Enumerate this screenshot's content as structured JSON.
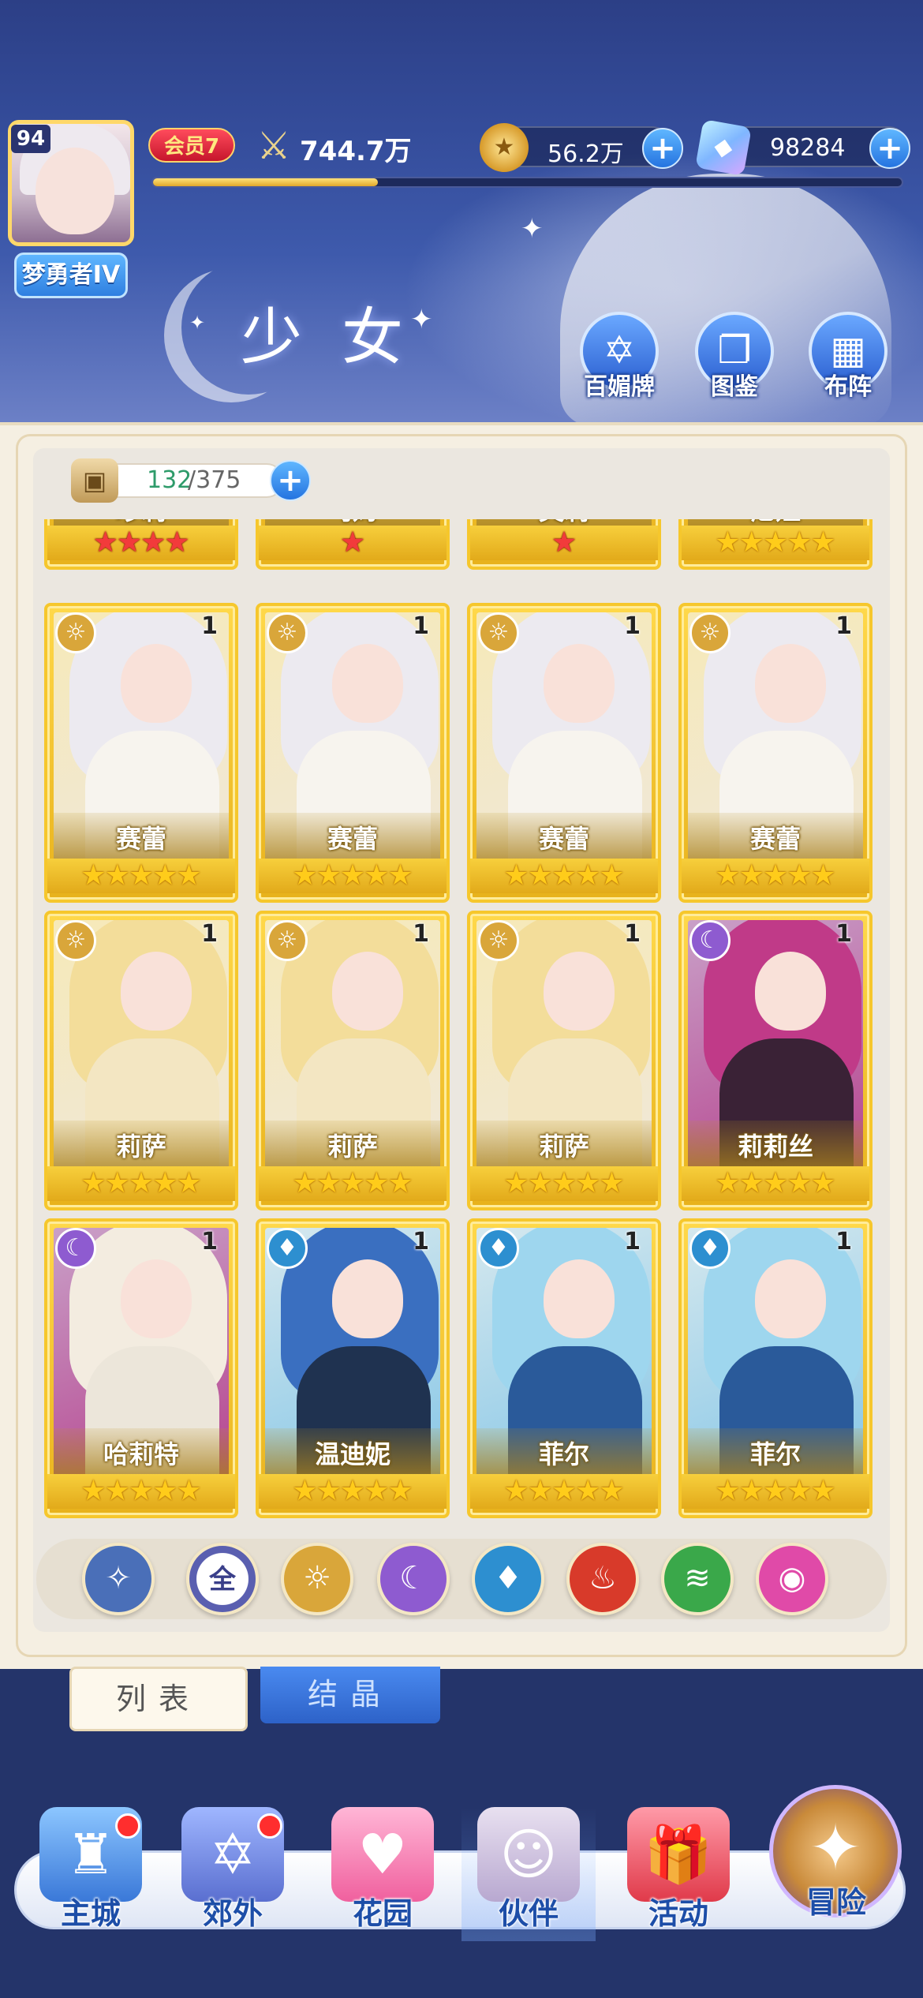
{
  "header": {
    "player_level": "94",
    "rank_title": "梦勇者IV",
    "vip_label": "会员7",
    "power_value": "744.7万",
    "power_progress": 0.3,
    "gold_value": "56.2万",
    "gem_value": "98284",
    "page_title": "少女",
    "menu": [
      {
        "label": "百媚牌",
        "icon": "card-deck-icon"
      },
      {
        "label": "图鉴",
        "icon": "book-icon"
      },
      {
        "label": "布阵",
        "icon": "formation-grid-icon"
      }
    ]
  },
  "collection": {
    "current": "132",
    "total": "/375"
  },
  "partial_row": [
    {
      "name": "珍莉",
      "stars": 4,
      "star_color": "red"
    },
    {
      "name": "乌姆",
      "stars": 1,
      "star_color": "red"
    },
    {
      "name": "芙莉",
      "stars": 1,
      "star_color": "red"
    },
    {
      "name": "尼娅",
      "stars": 5,
      "star_color": "gold"
    }
  ],
  "cards": [
    {
      "name": "赛蕾",
      "count": "1",
      "element": "light",
      "stars": 5
    },
    {
      "name": "赛蕾",
      "count": "1",
      "element": "light",
      "stars": 5
    },
    {
      "name": "赛蕾",
      "count": "1",
      "element": "light",
      "stars": 5
    },
    {
      "name": "赛蕾",
      "count": "1",
      "element": "light",
      "stars": 5
    },
    {
      "name": "莉萨",
      "count": "1",
      "element": "light",
      "stars": 5
    },
    {
      "name": "莉萨",
      "count": "1",
      "element": "light",
      "stars": 5
    },
    {
      "name": "莉萨",
      "count": "1",
      "element": "light",
      "stars": 5
    },
    {
      "name": "莉莉丝",
      "count": "1",
      "element": "dark",
      "stars": 5
    },
    {
      "name": "哈莉特",
      "count": "1",
      "element": "dark",
      "stars": 5
    },
    {
      "name": "温迪妮",
      "count": "1",
      "element": "water",
      "stars": 5
    },
    {
      "name": "菲尔",
      "count": "1",
      "element": "water",
      "stars": 5
    },
    {
      "name": "菲尔",
      "count": "1",
      "element": "water",
      "stars": 5
    }
  ],
  "filters": [
    {
      "label": "",
      "icon": "special-filter-icon",
      "color": "#4a6fb8"
    },
    {
      "label": "全",
      "icon": "all-filter-icon",
      "color": "#5a5fb0"
    },
    {
      "label": "",
      "icon": "light-element-icon",
      "color": "#d9a63a"
    },
    {
      "label": "",
      "icon": "dark-element-icon",
      "color": "#8e5bd0"
    },
    {
      "label": "",
      "icon": "water-element-icon",
      "color": "#2d8fd0"
    },
    {
      "label": "",
      "icon": "fire-element-icon",
      "color": "#d83a2a"
    },
    {
      "label": "",
      "icon": "wind-element-icon",
      "color": "#3aa84a"
    },
    {
      "label": "",
      "icon": "heart-element-icon",
      "color": "#e04aa8"
    }
  ],
  "tabs": {
    "list": "列表",
    "crystal": "结晶"
  },
  "nav": [
    {
      "label": "主城",
      "icon": "castle-icon",
      "badge": true
    },
    {
      "label": "郊外",
      "icon": "portal-icon",
      "badge": true
    },
    {
      "label": "花园",
      "icon": "heart-garden-icon",
      "badge": false
    },
    {
      "label": "伙伴",
      "icon": "partner-avatar-icon",
      "badge": false,
      "active": true
    },
    {
      "label": "活动",
      "icon": "gift-icon",
      "badge": false
    },
    {
      "label": "冒险",
      "icon": "compass-icon",
      "badge": false
    }
  ],
  "element_colors": {
    "light": "#d9a63a",
    "dark": "#8e5bd0",
    "water": "#2d8fd0"
  }
}
